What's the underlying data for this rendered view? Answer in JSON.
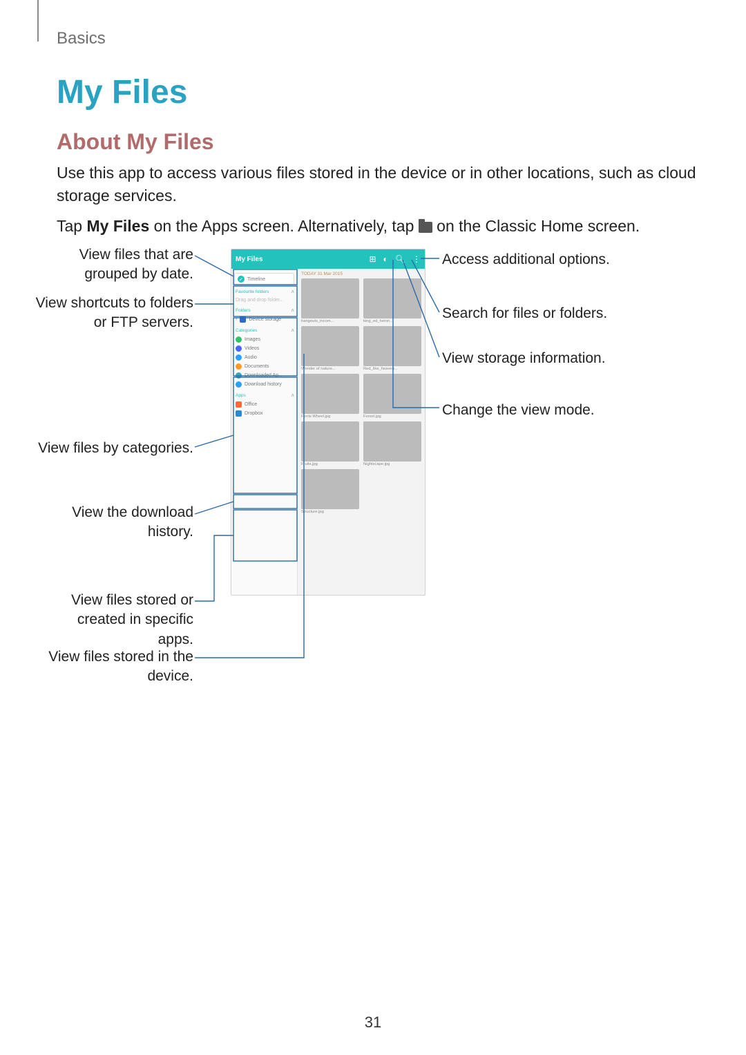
{
  "section": "Basics",
  "title": "My Files",
  "subtitle": "About My Files",
  "para1": "Use this app to access various files stored in the device or in other locations, such as cloud storage services.",
  "para2_a": "Tap ",
  "para2_b_bold": "My Files",
  "para2_c": " on the Apps screen. Alternatively, tap ",
  "para2_d": " on the Classic Home screen.",
  "callouts": {
    "left": {
      "timeline": "View files that are grouped by date.",
      "shortcuts": "View shortcuts to folders or FTP servers.",
      "categories": "View files by categories.",
      "download": "View the download history.",
      "apps": "View files stored or created in specific apps.",
      "device": "View files stored in the device."
    },
    "right": {
      "options": "Access additional options.",
      "search": "Search for files or folders.",
      "storage": "View storage information.",
      "viewmode": "Change the view mode."
    }
  },
  "screenshot": {
    "app_title": "My Files",
    "icons": {
      "view": "view-mode-icon",
      "storage": "storage-icon",
      "search": "search-icon",
      "more": "more-icon",
      "chevron": "chevron-up"
    },
    "sidebar": {
      "timeline": "Timeline",
      "fav_hdr": "Favourite folders",
      "fav_hint": "Drag and drop folder...",
      "folders_hdr": "Folders",
      "device_storage": "Device storage",
      "categories_hdr": "Categories",
      "cat_images": "Images",
      "cat_videos": "Videos",
      "cat_audio": "Audio",
      "cat_docs": "Documents",
      "cat_dl_apps": "Downloaded Ap...",
      "cat_dl_hist": "Download history",
      "apps_hdr": "Apps",
      "app_office": "Office",
      "app_dropbox": "Dropbox"
    },
    "main": {
      "date": "TODAY  31 Mar 2015",
      "thumbs": [
        {
          "cap": "hangouts_incom..."
        },
        {
          "cap": "king_ed_heron..."
        },
        {
          "cap": "Wonder of nature..."
        },
        {
          "cap": "Red_like_heaven..."
        },
        {
          "cap": "Ferris Wheel.jpg"
        },
        {
          "cap": "Forest.jpg"
        },
        {
          "cap": "Fruits.jpg"
        },
        {
          "cap": "Nightscape.jpg"
        },
        {
          "cap": "Structure.jpg"
        }
      ]
    }
  },
  "page_number": "31"
}
